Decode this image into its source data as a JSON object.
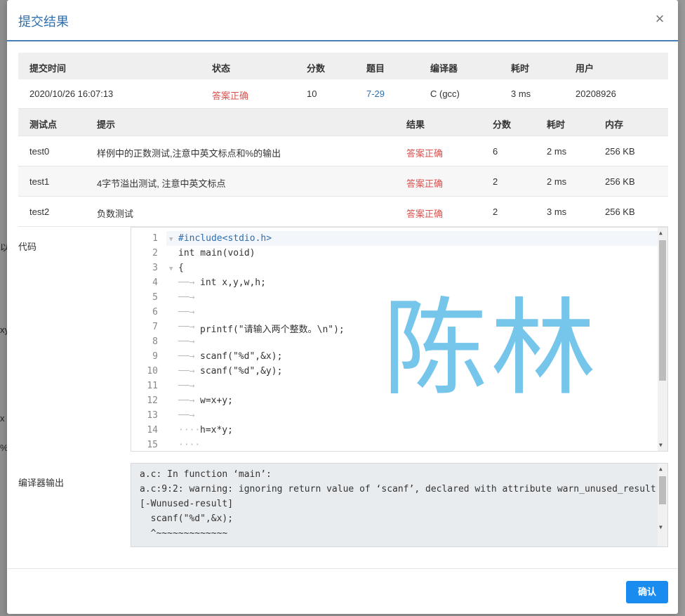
{
  "dialog": {
    "title": "提交结果",
    "close_icon": "×",
    "confirm_label": "确认"
  },
  "summary": {
    "headers": [
      "提交时间",
      "状态",
      "分数",
      "题目",
      "编译器",
      "耗时",
      "用户"
    ],
    "row": {
      "time": "2020/10/26 16:07:13",
      "status": "答案正确",
      "score": "10",
      "problem": "7-29",
      "compiler": "C (gcc)",
      "duration": "3 ms",
      "user": "20208926"
    }
  },
  "tests": {
    "headers": [
      "测试点",
      "提示",
      "结果",
      "分数",
      "耗时",
      "内存"
    ],
    "rows": [
      {
        "id": "test0",
        "hint": "样例中的正数测试,注意中英文标点和%的输出",
        "result": "答案正确",
        "score": "6",
        "time": "2 ms",
        "memory": "256 KB"
      },
      {
        "id": "test1",
        "hint": "4字节溢出测试, 注意中英文标点",
        "result": "答案正确",
        "score": "2",
        "time": "2 ms",
        "memory": "256 KB"
      },
      {
        "id": "test2",
        "hint": "负数测试",
        "result": "答案正确",
        "score": "2",
        "time": "3 ms",
        "memory": "256 KB"
      }
    ]
  },
  "code": {
    "label": "代码",
    "line_numbers": [
      "1",
      "2",
      "3",
      "4",
      "5",
      "6",
      "7",
      "8",
      "9",
      "10",
      "11",
      "12",
      "13",
      "14",
      "15"
    ],
    "lines": [
      "#include<stdio.h>",
      "int main(void)",
      "{",
      "int x,y,w,h;",
      "",
      "",
      "printf(\"请输入两个整数。\\n\");",
      "",
      "scanf(\"%d\",&x);",
      "scanf(\"%d\",&y);",
      "",
      "w=x+y;",
      "",
      "h=x*y;",
      ""
    ],
    "watermark": "陈林"
  },
  "compiler_output": {
    "label": "编译器输出",
    "lines": [
      "a.c: In function ‘main’:",
      "a.c:9:2: warning: ignoring return value of ‘scanf’, declared with attribute warn_unused_result",
      "[-Wunused-result]",
      "  scanf(\"%d\",&x);",
      "  ^~~~~~~~~~~~~~"
    ]
  },
  "background": {
    "fragments": [
      "以",
      "xy",
      "x",
      "%"
    ]
  }
}
